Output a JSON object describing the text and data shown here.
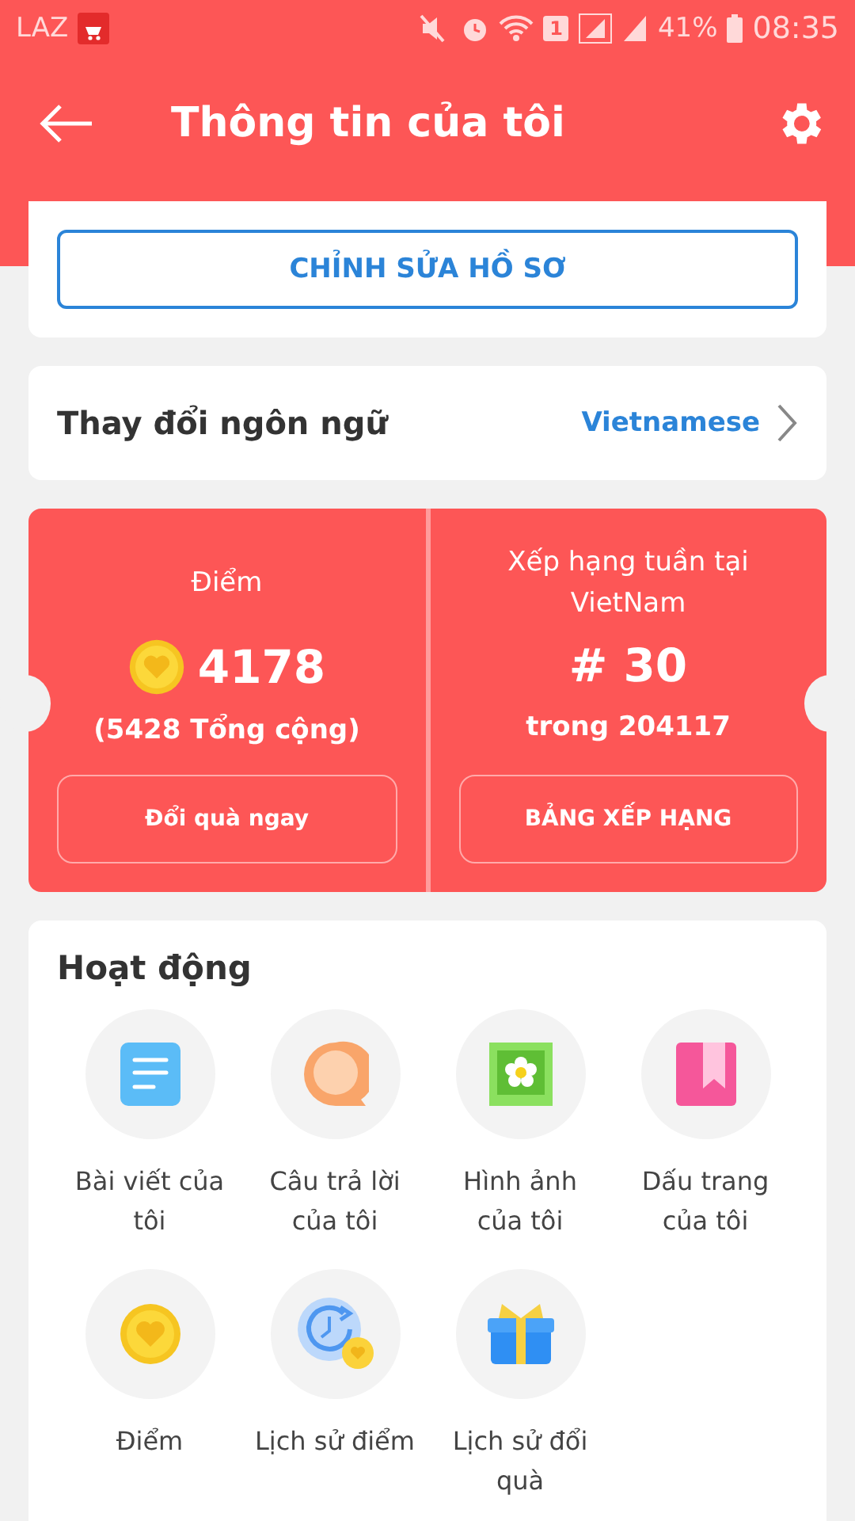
{
  "status_bar": {
    "carrier": "LAZ",
    "battery": "41%",
    "time": "08:35",
    "sim_slot": "1"
  },
  "header": {
    "title": "Thông tin của tôi"
  },
  "edit_profile": {
    "label": "CHỈNH SỬA HỒ SƠ"
  },
  "language": {
    "label": "Thay đổi ngôn ngữ",
    "value": "Vietnamese"
  },
  "points": {
    "title": "Điểm",
    "value": "4178",
    "total": "(5428 Tổng cộng)",
    "button": "Đổi quà ngay"
  },
  "ranking": {
    "title": "Xếp hạng tuần tại VietNam",
    "rank": "# 30",
    "out_of": "trong 204117",
    "button": "BẢNG XẾP HẠNG"
  },
  "activities": {
    "title": "Hoạt động",
    "items": [
      {
        "kind": "post",
        "label": "Bài viết của tôi"
      },
      {
        "kind": "answer",
        "label": "Câu trả lời của tôi"
      },
      {
        "kind": "photo",
        "label": "Hình ảnh của tôi"
      },
      {
        "kind": "bookmark",
        "label": "Dấu trang của tôi"
      },
      {
        "kind": "coin",
        "label": "Điểm"
      },
      {
        "kind": "history",
        "label": "Lịch sử điểm"
      },
      {
        "kind": "gift",
        "label": "Lịch sử đổi quà"
      }
    ]
  }
}
